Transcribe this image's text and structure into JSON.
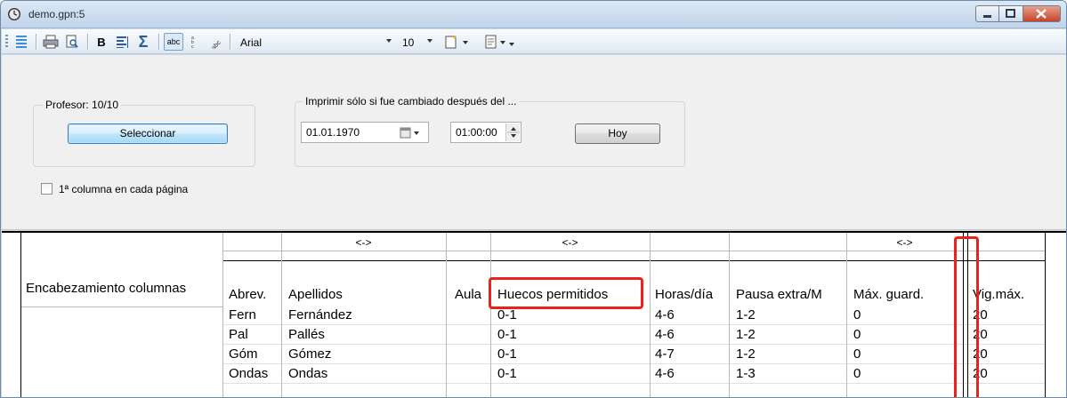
{
  "window": {
    "title": "demo.gpn:5"
  },
  "toolbar": {
    "font_name": "Arial",
    "font_size": "10",
    "bold_label": "B",
    "sigma_label": "Σ",
    "abc_label": "abc"
  },
  "panel": {
    "teacher_group_label": "Profesor: 10/10",
    "select_button": "Seleccionar",
    "changed_group_label": "Imprimir sólo si fue cambiado después del ...",
    "date_value": "01.01.1970",
    "time_value": "01:00:00",
    "today_button": "Hoy",
    "first_column_checkbox_label": "1ª columna en cada página",
    "first_column_checked": false
  },
  "grid": {
    "row_header_label": "Encabezamiento columnas",
    "swap_marker": "<->",
    "columns": [
      "Abrev.",
      "Apellidos",
      "Aula",
      "Huecos permitidos",
      "Horas/día",
      "Pausa extra/M",
      "Máx. guard.",
      "Vig.máx."
    ],
    "rows": [
      [
        "Fern",
        "Fernández",
        "",
        "0-1",
        "4-6",
        "1-2",
        "0",
        "20"
      ],
      [
        "Pal",
        "Pallés",
        "",
        "0-1",
        "4-6",
        "1-2",
        "0",
        "20"
      ],
      [
        "Góm",
        "Gómez",
        "",
        "0-1",
        "4-7",
        "1-2",
        "0",
        "20"
      ],
      [
        "Ondas",
        "Ondas",
        "",
        "0-1",
        "4-6",
        "1-3",
        "0",
        "20"
      ]
    ]
  },
  "colors": {
    "highlight": "#e8221d",
    "title_bar": "#c1d4ea"
  }
}
